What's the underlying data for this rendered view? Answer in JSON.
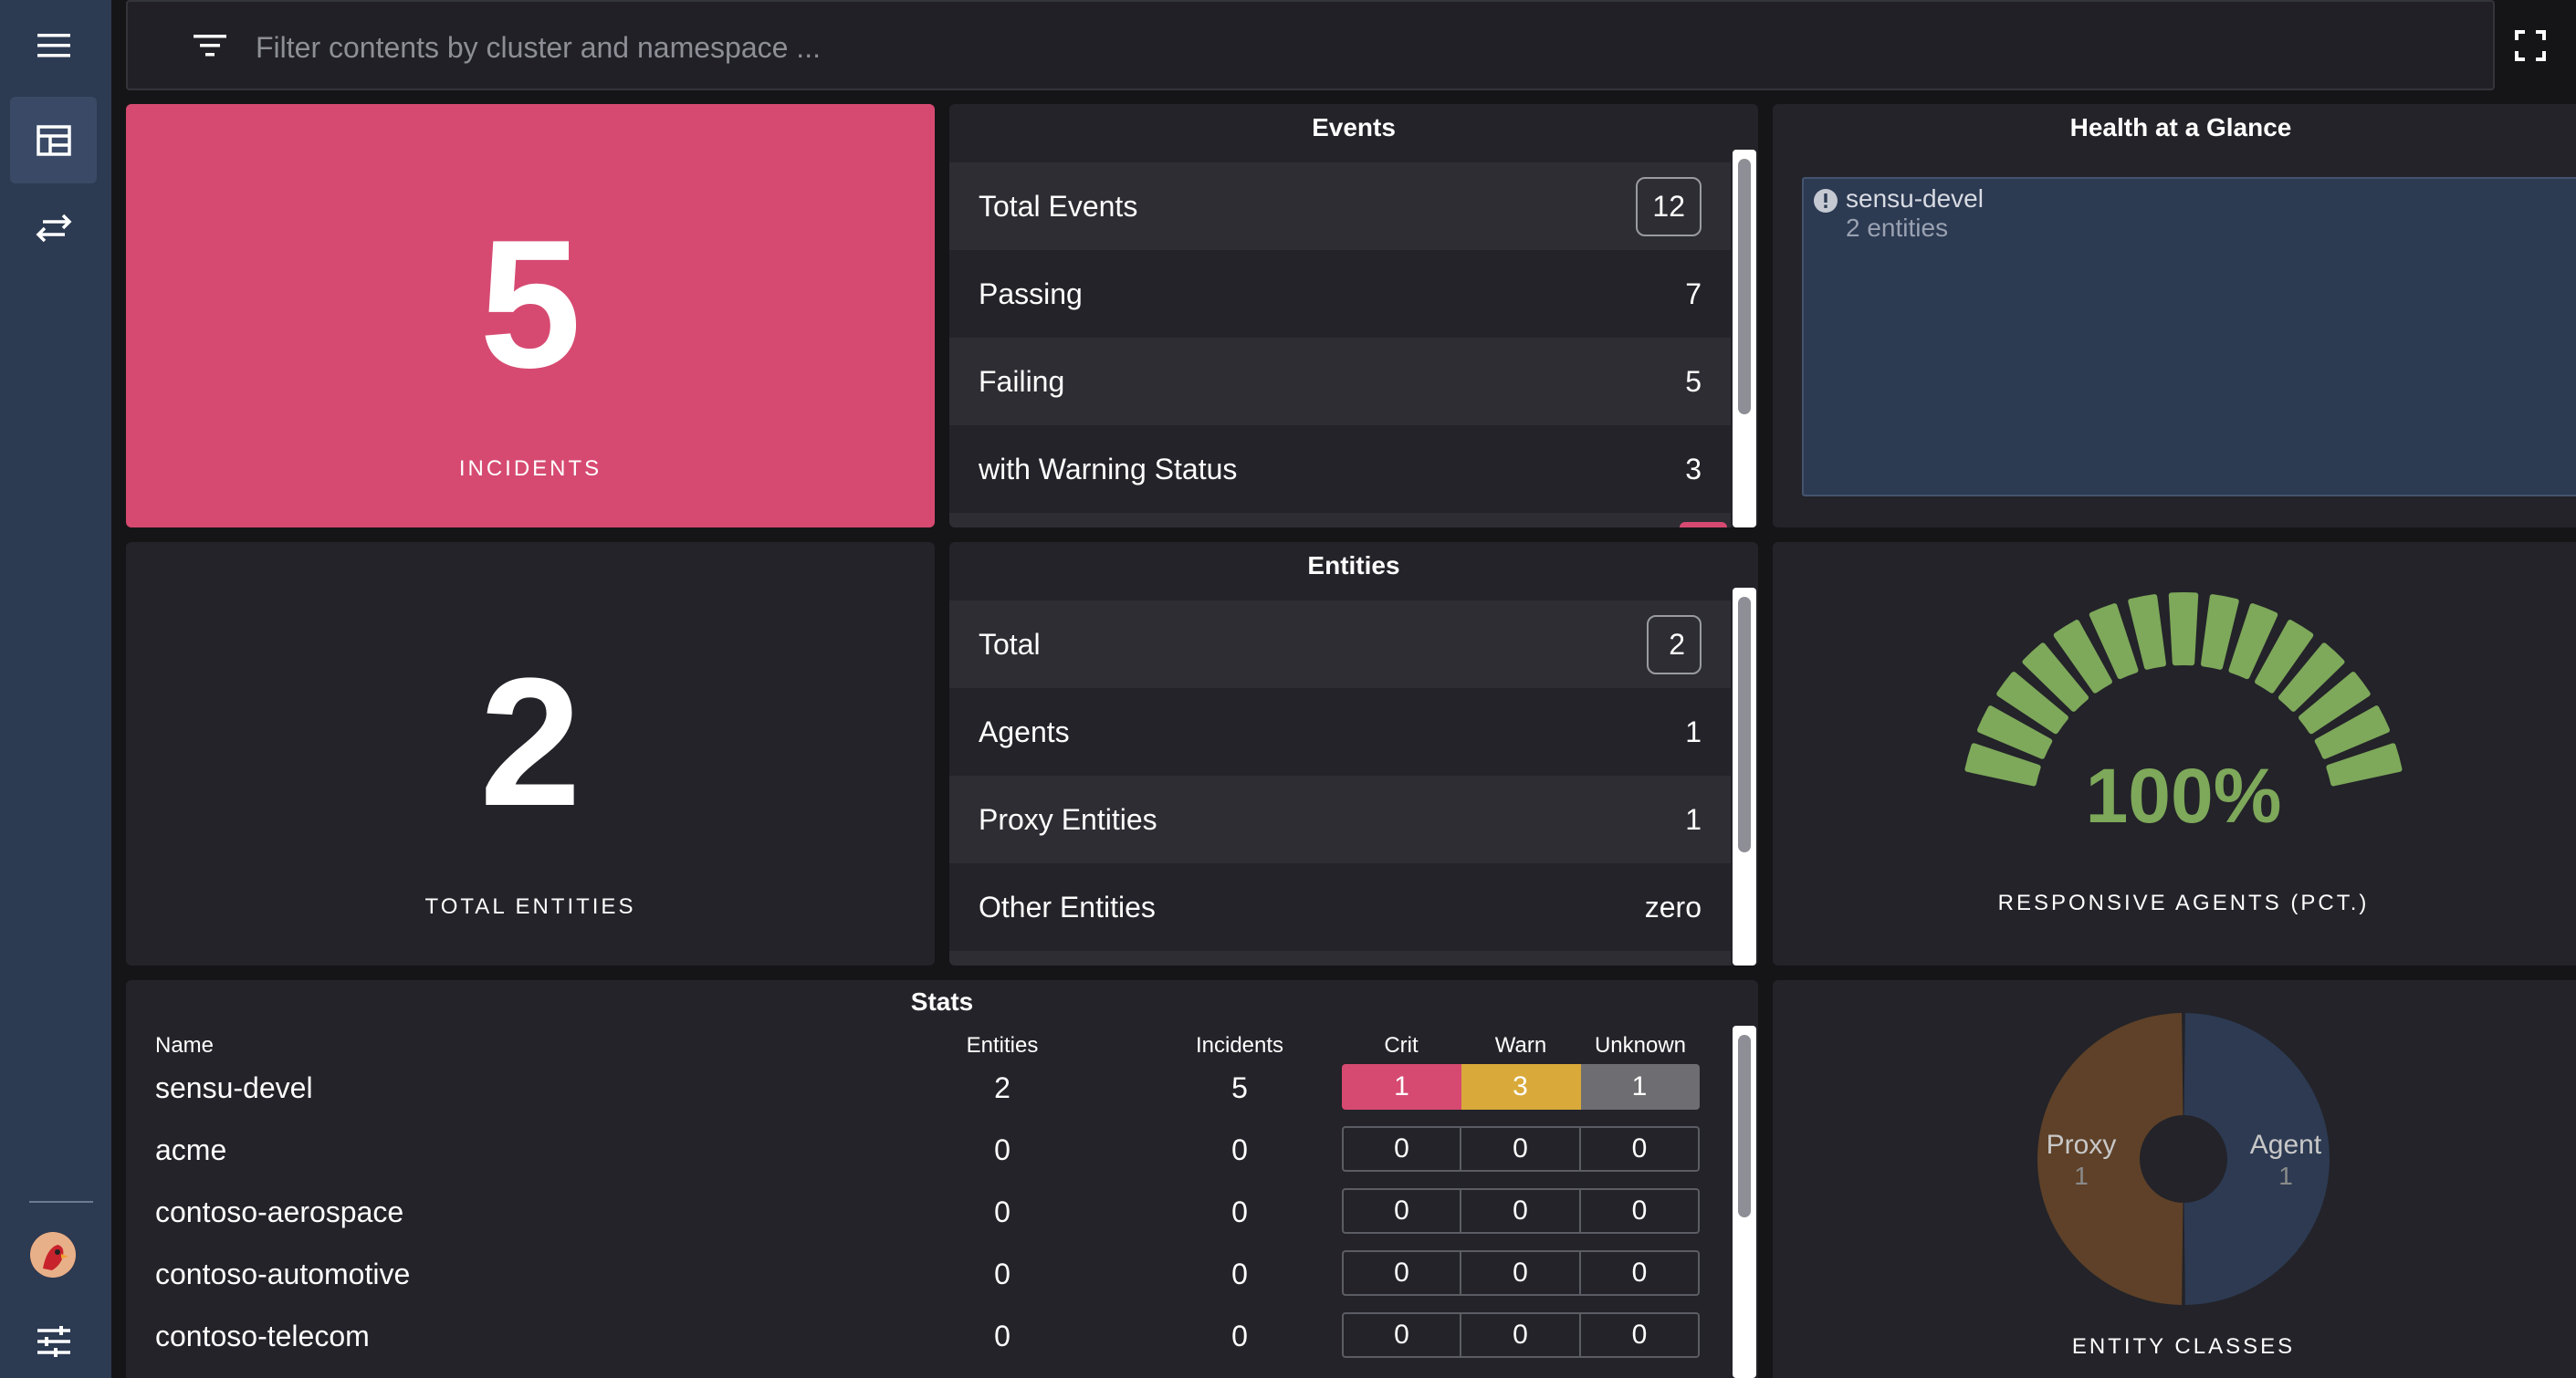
{
  "colors": {
    "sidebar_bg": "#2c3a52",
    "incident_red": "#d64a71",
    "warn_yellow": "#d9a93a",
    "unknown_grey": "#6e6e72",
    "gauge_green": "#7ea85a",
    "proxy_brown": "#5e4128",
    "agent_navy": "#2d3a52"
  },
  "sidebar": {
    "menu_icon": "hamburger-menu-icon",
    "items": [
      {
        "icon": "dashboard-icon",
        "active": true
      },
      {
        "icon": "swap-arrows-icon",
        "active": false
      }
    ],
    "bottom": [
      {
        "icon": "avatar"
      },
      {
        "icon": "sliders-settings-icon"
      }
    ]
  },
  "search": {
    "icon": "filter-icon",
    "placeholder": "Filter contents by cluster and namespace ...",
    "fullscreen_icon": "fullscreen-icon"
  },
  "incidents": {
    "value": "5",
    "label": "INCIDENTS"
  },
  "events": {
    "title": "Events",
    "rows": [
      {
        "label": "Total Events",
        "value": "12",
        "boxed": true
      },
      {
        "label": "Passing",
        "value": "7"
      },
      {
        "label": "Failing",
        "value": "5"
      },
      {
        "label": "with Warning Status",
        "value": "3"
      }
    ]
  },
  "health": {
    "title": "Health at a Glance",
    "items": [
      {
        "name": "sensu-devel",
        "detail": "2 entities",
        "icon": "alert-circle-icon"
      }
    ]
  },
  "total_entities": {
    "value": "2",
    "label": "TOTAL ENTITIES"
  },
  "entities": {
    "title": "Entities",
    "rows": [
      {
        "label": "Total",
        "value": "2",
        "boxed": true
      },
      {
        "label": "Agents",
        "value": "1"
      },
      {
        "label": "Proxy Entities",
        "value": "1"
      },
      {
        "label": "Other Entities",
        "value": "zero"
      }
    ]
  },
  "gauge": {
    "value_text": "100%",
    "fraction": 1.0,
    "label": "RESPONSIVE AGENTS (PCT.)"
  },
  "stats": {
    "title": "Stats",
    "headers": {
      "name": "Name",
      "entities": "Entities",
      "incidents": "Incidents",
      "crit": "Crit",
      "warn": "Warn",
      "unknown": "Unknown"
    },
    "rows": [
      {
        "name": "sensu-devel",
        "entities": "2",
        "incidents": "5",
        "crit": "1",
        "warn": "3",
        "unknown": "1"
      },
      {
        "name": "acme",
        "entities": "0",
        "incidents": "0",
        "crit": "0",
        "warn": "0",
        "unknown": "0"
      },
      {
        "name": "contoso-aerospace",
        "entities": "0",
        "incidents": "0",
        "crit": "0",
        "warn": "0",
        "unknown": "0"
      },
      {
        "name": "contoso-automotive",
        "entities": "0",
        "incidents": "0",
        "crit": "0",
        "warn": "0",
        "unknown": "0"
      },
      {
        "name": "contoso-telecom",
        "entities": "0",
        "incidents": "0",
        "crit": "0",
        "warn": "0",
        "unknown": "0"
      }
    ]
  },
  "entity_classes": {
    "label": "ENTITY CLASSES",
    "slices": [
      {
        "name": "Proxy",
        "value": "1"
      },
      {
        "name": "Agent",
        "value": "1"
      }
    ]
  }
}
